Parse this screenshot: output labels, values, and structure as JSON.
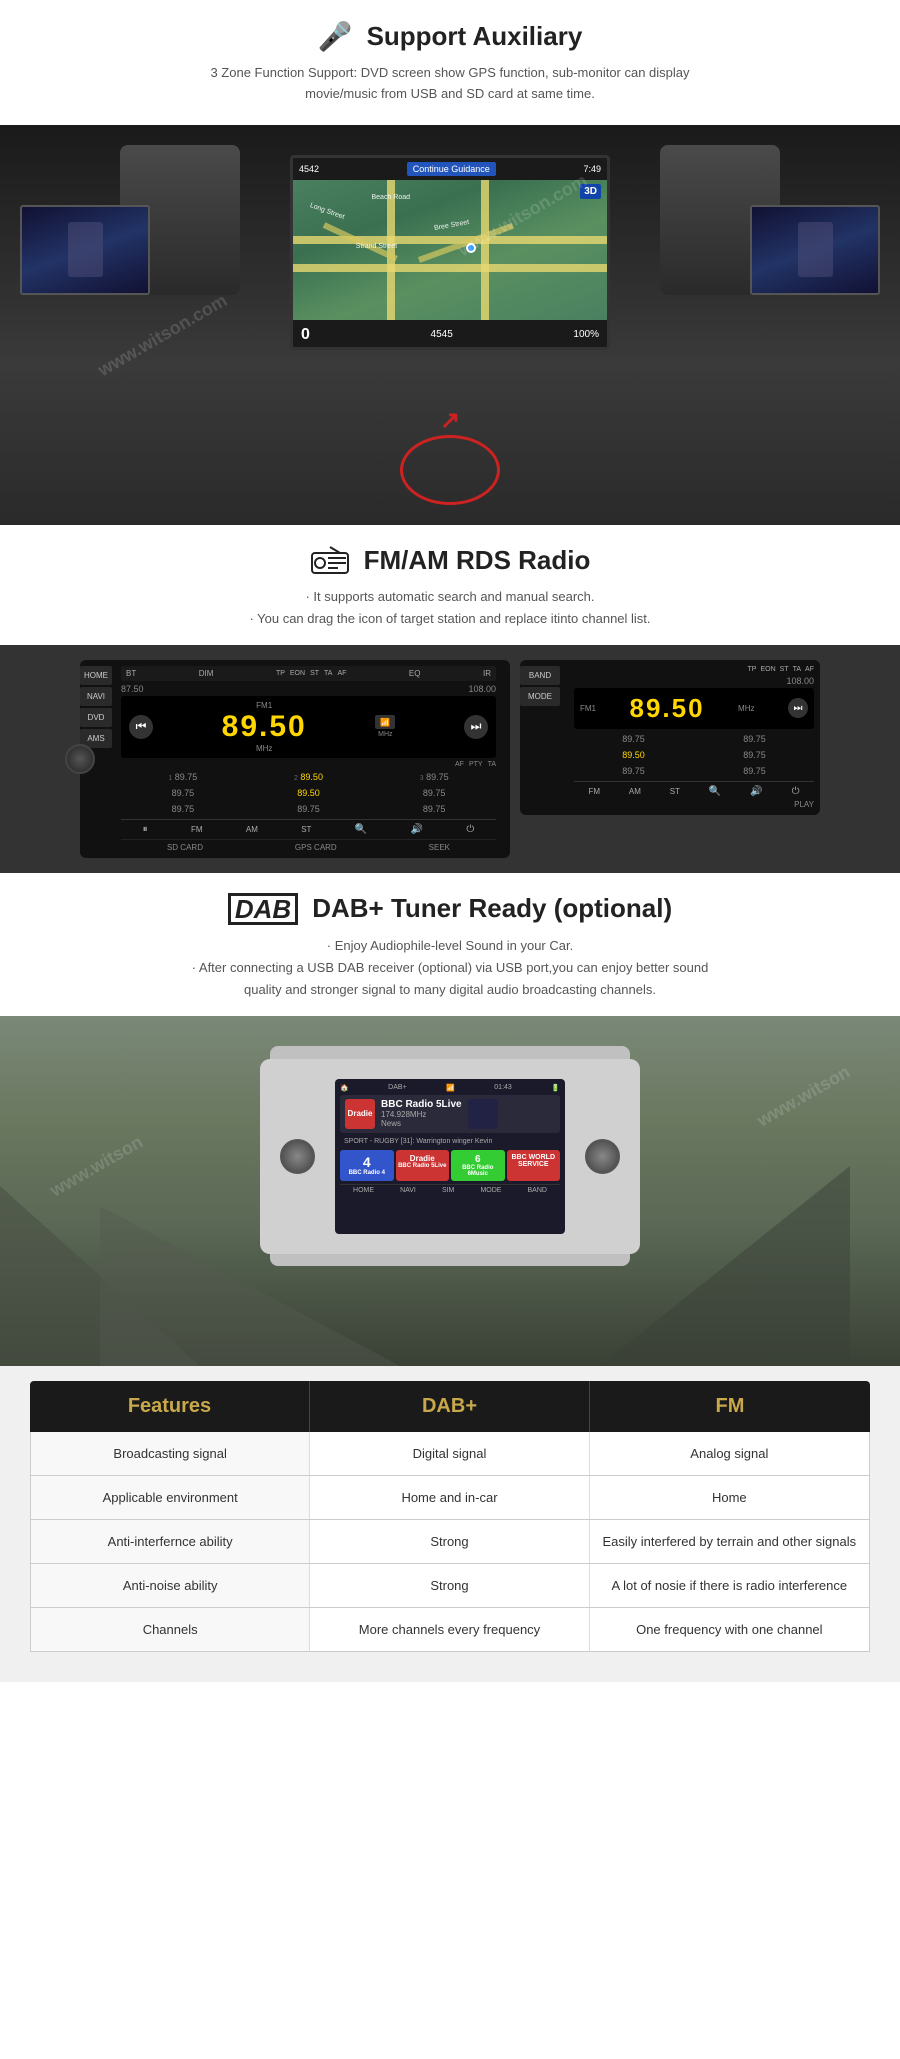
{
  "auxiliary": {
    "icon": "🎤",
    "title": "Support Auxiliary",
    "description": "3 Zone Function Support: DVD screen show GPS function, sub-monitor can display\nmovie/music from USB and SD card at same time."
  },
  "gps": {
    "continue_guidance": "Continue Guidance",
    "time": "7:49",
    "speed_label": "0",
    "badge_3d": "3D",
    "bottom_num": "4545",
    "progress": "100%"
  },
  "radio": {
    "title": "FM/AM RDS Radio",
    "desc_line1": "· It supports automatic search and manual search.",
    "desc_line2": "· You can drag the icon of target station and replace itinto channel list.",
    "freq_left": "87.50",
    "freq_right": "108.00",
    "freq_main": "89.50",
    "unit_mhz": "MHz",
    "label_fm1": "FM1",
    "presets": [
      "89.75",
      "89.50",
      "89.75",
      "89.75",
      "89.50",
      "89.75",
      "89.75",
      "89.75",
      "89.75"
    ],
    "preset_active": "89.50",
    "bottom_labels": [
      "SD CARD",
      "GPS CARD",
      "SEEK"
    ],
    "side_buttons": [
      "BAND",
      "MODE"
    ],
    "top_labels": [
      "BT",
      "DIM",
      "",
      "",
      "",
      "",
      "",
      "EQ",
      "IR"
    ],
    "nav_buttons": [
      "HOME",
      "NAVI",
      "DVD",
      "AMS"
    ]
  },
  "dab": {
    "logo": "DAB",
    "title": "DAB+ Tuner Ready (optional)",
    "desc_line1": "· Enjoy Audiophile-level Sound in your Car.",
    "desc_line2": "· After connecting a USB DAB receiver (optional) via USB port,you can enjoy better sound",
    "desc_line3": "quality and stronger signal to many digital audio broadcasting channels.",
    "screen": {
      "label": "DAB+",
      "station_name": "BBC Radio 5Live",
      "freq": "174.928MHz",
      "type": "News",
      "sport_info": "SPORT - RUGBY [31]: Warrington winger Kevin",
      "time": "01:43",
      "tiles": [
        {
          "label": "BBC Radio 4",
          "class": "dab-tile-4"
        },
        {
          "label": "BBC Radio 5Live",
          "class": "dab-tile-5live"
        },
        {
          "label": "BBC Radio 6Music",
          "class": "dab-tile-6music"
        },
        {
          "label": "BBC World Service",
          "class": "dab-tile-bbc"
        }
      ]
    }
  },
  "features": {
    "header": {
      "col1": "Features",
      "col2": "DAB+",
      "col3": "FM"
    },
    "rows": [
      {
        "label": "Broadcasting signal",
        "dab": "Digital signal",
        "fm": "Analog signal"
      },
      {
        "label": "Applicable environment",
        "dab": "Home and in-car",
        "fm": "Home"
      },
      {
        "label": "Anti-interfernce ability",
        "dab": "Strong",
        "fm": "Easily interfered by terrain and other signals"
      },
      {
        "label": "Anti-noise ability",
        "dab": "Strong",
        "fm": "A lot of nosie if there is radio interference"
      },
      {
        "label": "Channels",
        "dab": "More channels every frequency",
        "fm": "One frequency with one channel"
      }
    ]
  }
}
